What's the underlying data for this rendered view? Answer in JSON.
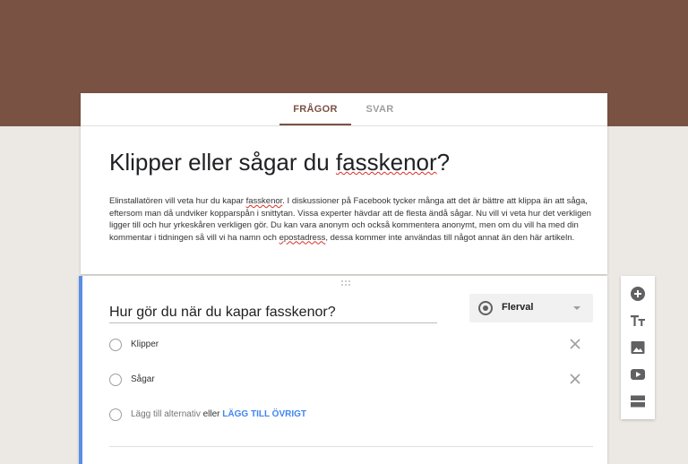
{
  "tabs": [
    {
      "label": "FRÅGOR",
      "active": true
    },
    {
      "label": "SVAR",
      "active": false
    }
  ],
  "form": {
    "title_before": "Klipper eller sågar du ",
    "title_misspelled": "fasskenor",
    "title_after": "?",
    "description": {
      "part1": "Elinstallatören vill veta hur du kapar ",
      "word1": "fasskenor",
      "part2": ". I diskussioner på Facebook tycker många att det är bättre att klippa än att såga, eftersom man då undviker kopparspån i snittytan.  Vissa experter hävdar att de flesta ändå sågar. Nu vill vi veta hur det verkligen ligger till och hur yrkeskåren verkligen gör. Du kan vara anonym och också kommentera anonymt, men om du vill ha med din kommentar i tidningen så vill vi ha namn och ",
      "word2": "epostadress",
      "part3": ", dessa kommer inte användas till något annat än den här artikeln."
    }
  },
  "question": {
    "text": "Hur gör du när du kapar fasskenor?",
    "type_label": "Flerval",
    "options": [
      {
        "label": "Klipper"
      },
      {
        "label": "Sågar"
      }
    ],
    "add_option_placeholder": "Lägg till alternativ",
    "add_option_or": "eller",
    "add_other_label": "LÄGG TILL ÖVRIGT"
  },
  "toolbar_icons": [
    "add-circle-icon",
    "title-text-icon",
    "image-icon",
    "video-icon",
    "section-icon"
  ],
  "colors": {
    "header_brown": "#7a5244",
    "background": "#ece9e4",
    "active_question_accent": "#5c8de6",
    "link_blue": "#4285f4"
  }
}
